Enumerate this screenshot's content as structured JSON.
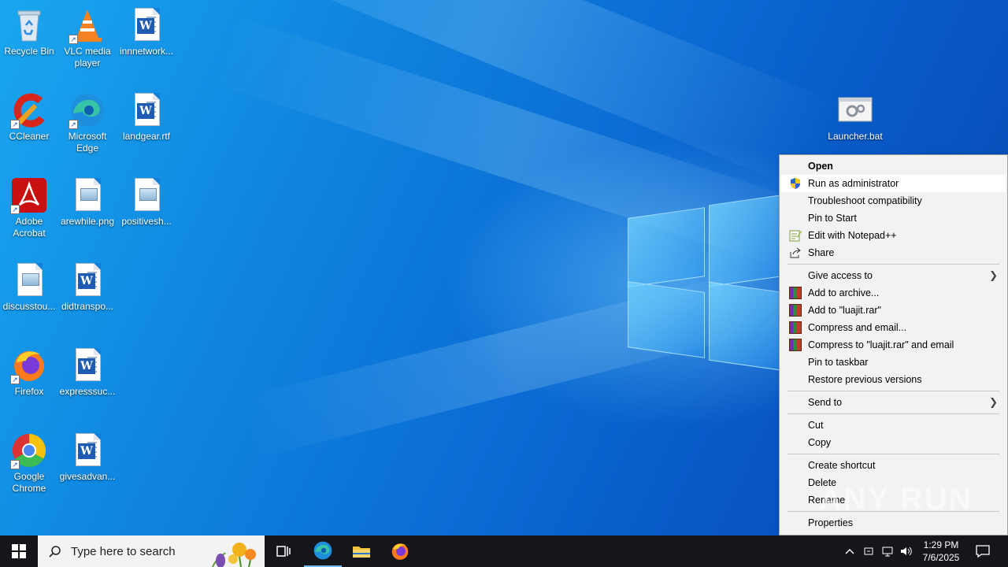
{
  "desktop": {
    "icons": [
      {
        "label": "Recycle Bin"
      },
      {
        "label": "VLC media player"
      },
      {
        "label": "innnetwork..."
      },
      {
        "label": "CCleaner"
      },
      {
        "label": "Microsoft Edge"
      },
      {
        "label": "landgear.rtf"
      },
      {
        "label": "Adobe Acrobat"
      },
      {
        "label": "arewhile.png"
      },
      {
        "label": "positivesh..."
      },
      {
        "label": "discusstou..."
      },
      {
        "label": "didtranspo..."
      },
      {
        "label": "Firefox"
      },
      {
        "label": "expresssuc..."
      },
      {
        "label": "Google Chrome"
      },
      {
        "label": "givesadvan..."
      },
      {
        "label": "Launcher.bat"
      }
    ]
  },
  "context_menu": {
    "items": [
      {
        "label": "Open"
      },
      {
        "label": "Run as administrator"
      },
      {
        "label": "Troubleshoot compatibility"
      },
      {
        "label": "Pin to Start"
      },
      {
        "label": "Edit with Notepad++"
      },
      {
        "label": "Share"
      },
      {
        "label": "Give access to"
      },
      {
        "label": "Add to archive..."
      },
      {
        "label": "Add to \"luajit.rar\""
      },
      {
        "label": "Compress and email..."
      },
      {
        "label": "Compress to \"luajit.rar\" and email"
      },
      {
        "label": "Pin to taskbar"
      },
      {
        "label": "Restore previous versions"
      },
      {
        "label": "Send to"
      },
      {
        "label": "Cut"
      },
      {
        "label": "Copy"
      },
      {
        "label": "Create shortcut"
      },
      {
        "label": "Delete"
      },
      {
        "label": "Rename"
      },
      {
        "label": "Properties"
      }
    ]
  },
  "watermark": {
    "text": "ANY RUN"
  },
  "taskbar": {
    "search_placeholder": "Type here to search",
    "time": "1:29 PM",
    "date": "7/6/2025"
  }
}
